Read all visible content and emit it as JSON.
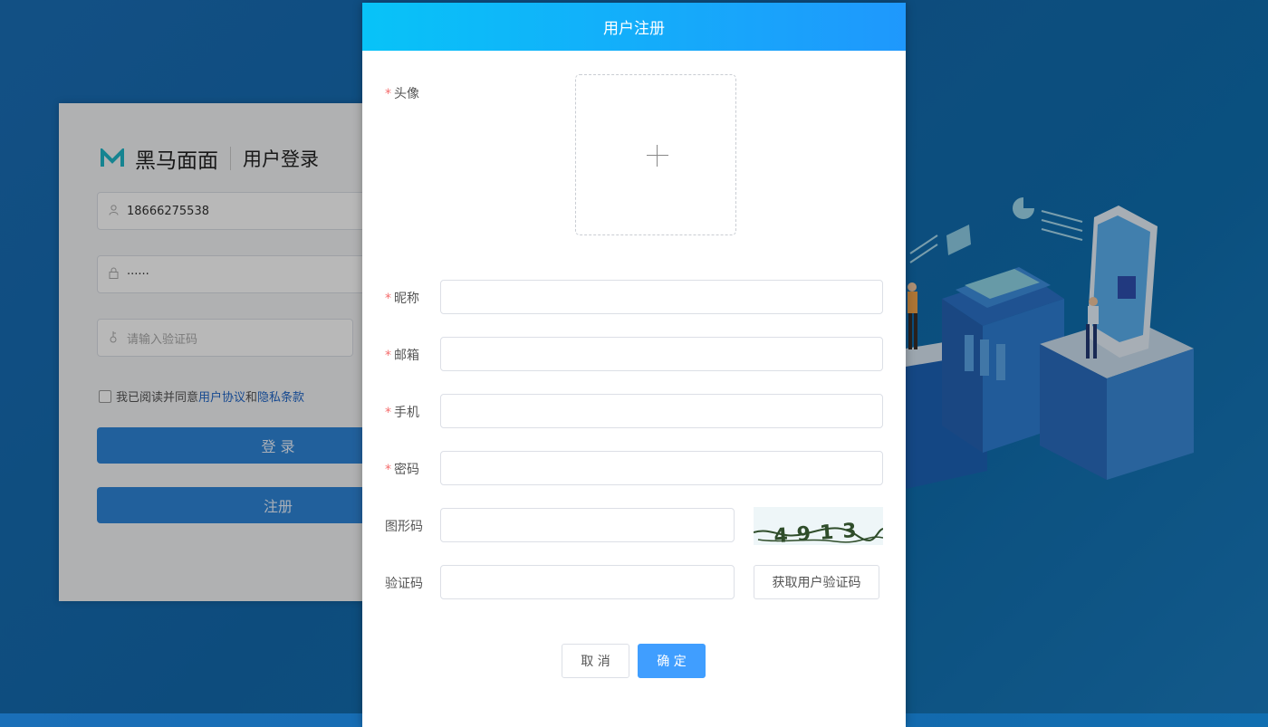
{
  "login": {
    "brand": "黑马面面",
    "title": "用户登录",
    "phone_value": "18666275538",
    "password_value": "······",
    "code_placeholder": "请输入验证码",
    "agree_prefix": "我已阅读并同意",
    "agree_link1": "用户协议",
    "agree_mid": "和",
    "agree_link2": "隐私条款",
    "login_button": "登 录",
    "register_button": "注册"
  },
  "dialog": {
    "title": "用户注册",
    "required_mark": "*",
    "avatar_label": "头像",
    "nickname_label": "昵称",
    "email_label": "邮箱",
    "phone_label": "手机",
    "password_label": "密码",
    "graphic_code_label": "图形码",
    "sms_code_label": "验证码",
    "captcha_text": "4913",
    "get_code_button": "获取用户验证码",
    "cancel_button": "取 消",
    "confirm_button": "确 定"
  },
  "colors": {
    "header_gradient_start": "#08c3f8",
    "header_gradient_end": "#1f98fc",
    "primary": "#409eff",
    "required": "#f56c6c"
  }
}
